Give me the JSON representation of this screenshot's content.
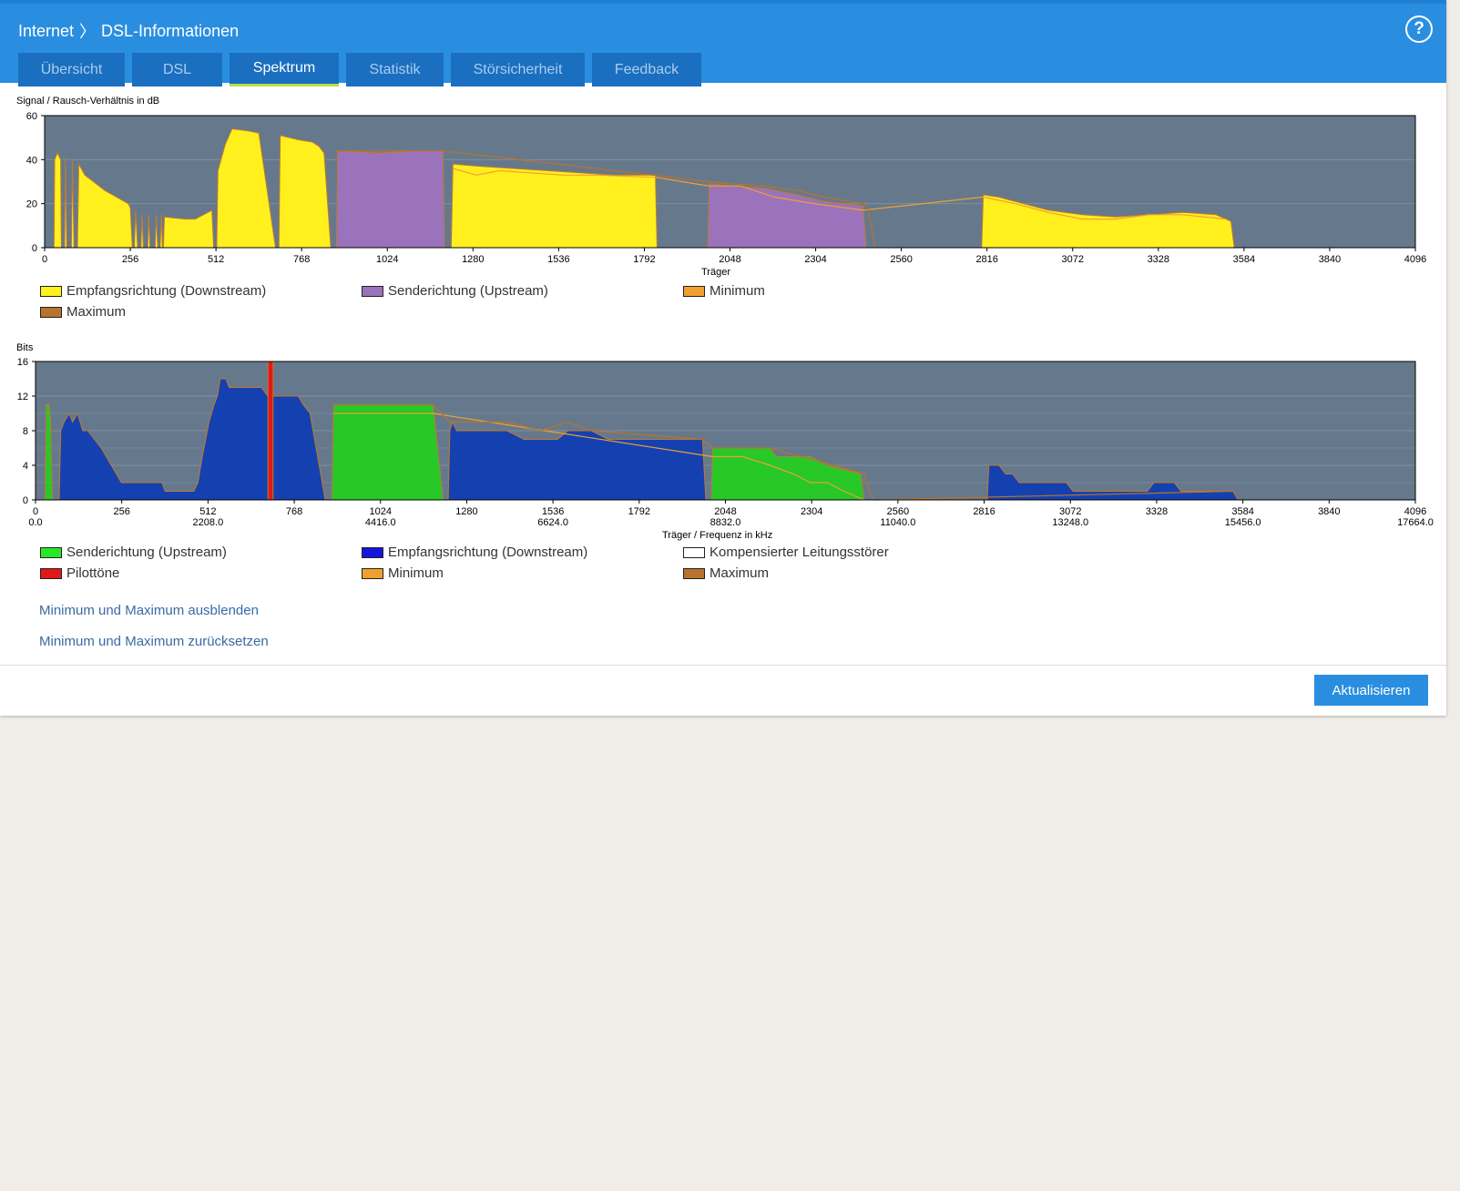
{
  "breadcrumb": {
    "parent": "Internet",
    "separator": "〉",
    "current": "DSL-Informationen"
  },
  "help_icon": "?",
  "tabs": [
    {
      "label": "Übersicht",
      "active": false
    },
    {
      "label": "DSL",
      "active": false
    },
    {
      "label": "Spektrum",
      "active": true
    },
    {
      "label": "Statistik",
      "active": false
    },
    {
      "label": "Störsicherheit",
      "active": false
    },
    {
      "label": "Feedback",
      "active": false
    }
  ],
  "colors": {
    "accent": "#2a8ee0",
    "chart_bg": "#66798c",
    "yellow": "#fff01e",
    "purple": "#9b72bc",
    "green": "#27c827",
    "blue": "#1541b0",
    "orange": "#f0a030",
    "brown": "#b8732e",
    "red": "#e01818"
  },
  "chart_data": [
    {
      "type": "area",
      "title": "Signal / Rausch-Verhältnis in dB",
      "xlabel": "Träger",
      "xlim": [
        0,
        4096
      ],
      "ylim": [
        0,
        60
      ],
      "x_ticks": [
        0,
        256,
        512,
        768,
        1024,
        1280,
        1536,
        1792,
        2048,
        2304,
        2560,
        2816,
        3072,
        3328,
        3584,
        3840,
        4096
      ],
      "y_ticks": [
        0,
        20,
        40,
        60
      ],
      "grid": true,
      "legend_position": "bottom",
      "legend": [
        {
          "label": "Empfangsrichtung (Downstream)",
          "color": "#fff01e"
        },
        {
          "label": "Senderichtung (Upstream)",
          "color": "#9b72bc"
        },
        {
          "label": "Minimum",
          "color": "#f0a030"
        },
        {
          "label": "Maximum",
          "color": "#b8732e"
        }
      ],
      "series": [
        {
          "name": "Empfangsrichtung (Downstream)",
          "color": "#fff01e",
          "points": [
            [
              28,
              0
            ],
            [
              30,
              40
            ],
            [
              38,
              43
            ],
            [
              48,
              40
            ],
            [
              50,
              0
            ],
            [
              60,
              0
            ],
            [
              62,
              41
            ],
            [
              66,
              0
            ],
            [
              80,
              0
            ],
            [
              83,
              40
            ],
            [
              88,
              0
            ],
            [
              98,
              0
            ],
            [
              102,
              38
            ],
            [
              120,
              33
            ],
            [
              180,
              26
            ],
            [
              250,
              20
            ],
            [
              256,
              18
            ],
            [
              262,
              0
            ],
            [
              268,
              0
            ],
            [
              272,
              17
            ],
            [
              278,
              0
            ],
            [
              288,
              0
            ],
            [
              291,
              15
            ],
            [
              295,
              0
            ],
            [
              308,
              0
            ],
            [
              311,
              15
            ],
            [
              315,
              0
            ],
            [
              330,
              0
            ],
            [
              334,
              15
            ],
            [
              338,
              0
            ],
            [
              345,
              0
            ],
            [
              349,
              15
            ],
            [
              352,
              0
            ],
            [
              355,
              0
            ],
            [
              358,
              14
            ],
            [
              420,
              13
            ],
            [
              450,
              13
            ],
            [
              500,
              17
            ],
            [
              505,
              0
            ],
            [
              514,
              0
            ],
            [
              518,
              35
            ],
            [
              540,
              47
            ],
            [
              560,
              54
            ],
            [
              610,
              53
            ],
            [
              640,
              52
            ],
            [
              690,
              0
            ],
            [
              700,
              0
            ],
            [
              704,
              51
            ],
            [
              760,
              49
            ],
            [
              800,
              48
            ],
            [
              820,
              46
            ],
            [
              835,
              43
            ],
            [
              855,
              0
            ],
            [
              1215,
              0
            ],
            [
              1220,
              38
            ],
            [
              1300,
              37
            ],
            [
              1400,
              36
            ],
            [
              1500,
              35
            ],
            [
              1600,
              34
            ],
            [
              1700,
              33
            ],
            [
              1790,
              33
            ],
            [
              1825,
              33
            ],
            [
              1830,
              0
            ],
            [
              2800,
              0
            ],
            [
              2805,
              24
            ],
            [
              2850,
              23
            ],
            [
              2900,
              21
            ],
            [
              3000,
              17
            ],
            [
              3100,
              15
            ],
            [
              3200,
              14
            ],
            [
              3300,
              15
            ],
            [
              3400,
              16
            ],
            [
              3500,
              15
            ],
            [
              3530,
              13
            ],
            [
              3545,
              12
            ],
            [
              3555,
              0
            ]
          ]
        },
        {
          "name": "Senderichtung (Upstream)",
          "color": "#9b72bc",
          "points": [
            [
              872,
              0
            ],
            [
              876,
              44
            ],
            [
              1000,
              43
            ],
            [
              1100,
              44
            ],
            [
              1190,
              44
            ],
            [
              1195,
              0
            ],
            [
              1982,
              0
            ],
            [
              1986,
              29
            ],
            [
              2050,
              28
            ],
            [
              2150,
              27
            ],
            [
              2250,
              24
            ],
            [
              2330,
              21
            ],
            [
              2445,
              19
            ],
            [
              2455,
              0
            ]
          ]
        },
        {
          "name": "Minimum",
          "color": "#f0a030",
          "points": [
            [
              1220,
              36
            ],
            [
              1290,
              33
            ],
            [
              1360,
              35
            ],
            [
              1450,
              34
            ],
            [
              1550,
              33
            ],
            [
              1650,
              33
            ],
            [
              1825,
              32
            ],
            [
              1986,
              28
            ],
            [
              2080,
              28
            ],
            [
              2180,
              23
            ],
            [
              2300,
              20
            ],
            [
              2445,
              17
            ],
            [
              2805,
              23
            ],
            [
              2900,
              20
            ],
            [
              3000,
              16
            ],
            [
              3100,
              13
            ],
            [
              3200,
              13
            ],
            [
              3300,
              15
            ],
            [
              3400,
              15
            ],
            [
              3530,
              13
            ]
          ]
        },
        {
          "name": "Maximum",
          "color": "#b8732e",
          "points": [
            [
              872,
              44
            ],
            [
              1000,
              44
            ],
            [
              1190,
              44
            ],
            [
              1986,
              30
            ],
            [
              2050,
              29
            ],
            [
              2150,
              28
            ],
            [
              2250,
              26
            ],
            [
              2330,
              23
            ],
            [
              2445,
              20
            ],
            [
              2458,
              19
            ],
            [
              2470,
              10
            ],
            [
              2480,
              0
            ]
          ]
        }
      ]
    },
    {
      "type": "area",
      "title": "Bits",
      "xlabel": "Träger / Frequenz in kHz",
      "xlim": [
        0,
        4096
      ],
      "ylim": [
        0,
        16
      ],
      "x_ticks": [
        0,
        256,
        512,
        768,
        1024,
        1280,
        1536,
        1792,
        2048,
        2304,
        2560,
        2816,
        3072,
        3328,
        3584,
        3840,
        4096
      ],
      "frequency_ticks": [
        {
          "carrier": 0,
          "label": "0.0"
        },
        {
          "carrier": 512,
          "label": "2208.0"
        },
        {
          "carrier": 1024,
          "label": "4416.0"
        },
        {
          "carrier": 1536,
          "label": "6624.0"
        },
        {
          "carrier": 2048,
          "label": "8832.0"
        },
        {
          "carrier": 2560,
          "label": "11040.0"
        },
        {
          "carrier": 3072,
          "label": "13248.0"
        },
        {
          "carrier": 3584,
          "label": "15456.0"
        },
        {
          "carrier": 4096,
          "label": "17664.0"
        }
      ],
      "y_ticks": [
        0,
        4,
        8,
        12,
        16
      ],
      "grid": true,
      "legend_position": "bottom",
      "legend": [
        {
          "label": "Senderichtung (Upstream)",
          "color": "#27e827"
        },
        {
          "label": "Empfangsrichtung (Downstream)",
          "color": "#1515e0"
        },
        {
          "label": "Kompensierter Leitungsstörer",
          "color": "#ffffff"
        },
        {
          "label": "Pilottöne",
          "color": "#e01818"
        },
        {
          "label": "Minimum",
          "color": "#f0a030"
        },
        {
          "label": "Maximum",
          "color": "#b8732e"
        }
      ],
      "series": [
        {
          "name": "Senderichtung (Upstream)",
          "color": "#27c827",
          "points": [
            [
              28,
              0
            ],
            [
              32,
              11
            ],
            [
              40,
              11
            ],
            [
              45,
              9
            ],
            [
              50,
              0
            ],
            [
              880,
              0
            ],
            [
              885,
              11
            ],
            [
              1000,
              11
            ],
            [
              1100,
              11
            ],
            [
              1180,
              11
            ],
            [
              1210,
              0
            ],
            [
              2006,
              0
            ],
            [
              2010,
              6
            ],
            [
              2100,
              6
            ],
            [
              2180,
              6
            ],
            [
              2200,
              5
            ],
            [
              2300,
              5
            ],
            [
              2350,
              4
            ],
            [
              2450,
              3
            ],
            [
              2460,
              0
            ]
          ]
        },
        {
          "name": "Empfangsrichtung (Downstream)",
          "color": "#1541b0",
          "points": [
            [
              70,
              0
            ],
            [
              75,
              8
            ],
            [
              85,
              9
            ],
            [
              100,
              10
            ],
            [
              110,
              9
            ],
            [
              125,
              10
            ],
            [
              140,
              8
            ],
            [
              155,
              8
            ],
            [
              175,
              7
            ],
            [
              195,
              6
            ],
            [
              210,
              5
            ],
            [
              225,
              4
            ],
            [
              240,
              3
            ],
            [
              255,
              2
            ],
            [
              375,
              2
            ],
            [
              385,
              1
            ],
            [
              470,
              1
            ],
            [
              482,
              2
            ],
            [
              495,
              5
            ],
            [
              515,
              9
            ],
            [
              530,
              11
            ],
            [
              540,
              12
            ],
            [
              548,
              14
            ],
            [
              565,
              14
            ],
            [
              575,
              13
            ],
            [
              670,
              13
            ],
            [
              690,
              12
            ],
            [
              780,
              12
            ],
            [
              795,
              11
            ],
            [
              815,
              10
            ],
            [
              860,
              0
            ],
            [
              1225,
              0
            ],
            [
              1230,
              8
            ],
            [
              1238,
              9
            ],
            [
              1250,
              8
            ],
            [
              1400,
              8
            ],
            [
              1450,
              7
            ],
            [
              1550,
              7
            ],
            [
              1580,
              8
            ],
            [
              1650,
              8
            ],
            [
              1700,
              7
            ],
            [
              1980,
              7
            ],
            [
              1990,
              0
            ],
            [
              2825,
              0
            ],
            [
              2830,
              4
            ],
            [
              2860,
              4
            ],
            [
              2880,
              3
            ],
            [
              2900,
              3
            ],
            [
              2920,
              2
            ],
            [
              3060,
              2
            ],
            [
              3080,
              1
            ],
            [
              3300,
              1
            ],
            [
              3320,
              2
            ],
            [
              3380,
              2
            ],
            [
              3400,
              1
            ],
            [
              3500,
              1
            ],
            [
              3555,
              1
            ],
            [
              3570,
              0
            ]
          ]
        },
        {
          "name": "Pilottöne",
          "color": "#e01818",
          "points": [
            [
              690,
              0
            ],
            [
              690,
              16
            ],
            [
              705,
              16
            ],
            [
              705,
              0
            ]
          ]
        },
        {
          "name": "Minimum",
          "color": "#f0a030",
          "points": [
            [
              885,
              10
            ],
            [
              1000,
              10
            ],
            [
              1100,
              10
            ],
            [
              1180,
              10
            ],
            [
              2010,
              5
            ],
            [
              2100,
              5
            ],
            [
              2180,
              4
            ],
            [
              2250,
              3
            ],
            [
              2300,
              2
            ],
            [
              2350,
              2
            ],
            [
              2400,
              1
            ],
            [
              2460,
              0
            ]
          ]
        },
        {
          "name": "Maximum",
          "color": "#b8732e",
          "points": [
            [
              885,
              11
            ],
            [
              1180,
              11
            ],
            [
              1230,
              9
            ],
            [
              1400,
              9
            ],
            [
              1500,
              8
            ],
            [
              1580,
              9
            ],
            [
              1650,
              8
            ],
            [
              1980,
              7
            ],
            [
              2010,
              6
            ],
            [
              2180,
              6
            ],
            [
              2460,
              3
            ],
            [
              2475,
              1
            ],
            [
              2490,
              0
            ],
            [
              3555,
              1
            ],
            [
              3570,
              0
            ]
          ]
        }
      ]
    }
  ],
  "links": {
    "hide_minmax": "Minimum und Maximum ausblenden",
    "reset_minmax": "Minimum und Maximum zurücksetzen"
  },
  "button": {
    "label": "Aktualisieren"
  }
}
